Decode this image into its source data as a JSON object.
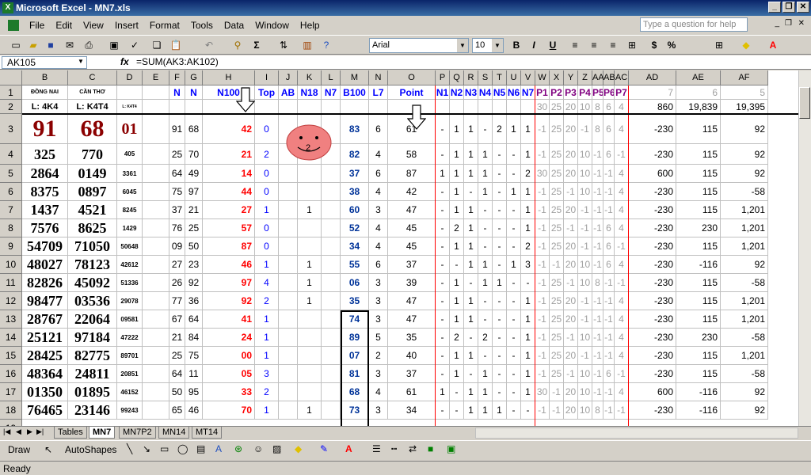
{
  "window": {
    "app_title": "Microsoft Excel - MN7.xls",
    "xl_mark": "X"
  },
  "menu": {
    "items": [
      "File",
      "Edit",
      "View",
      "Insert",
      "Format",
      "Tools",
      "Data",
      "Window",
      "Help"
    ],
    "help_placeholder": "Type a question for help"
  },
  "format": {
    "font": "Arial",
    "size": "10",
    "bold": "B",
    "italic": "I",
    "underline": "U",
    "currency": "$",
    "percent": "%"
  },
  "icons": {
    "new": "new-document-icon",
    "open": "folder-open-icon",
    "save": "save-icon",
    "sigma": "Σ"
  },
  "formula": {
    "name_box": "AK105",
    "fx": "fx",
    "text": "=SUM(AK3:AK102)"
  },
  "columns": [
    "B",
    "C",
    "D",
    "E",
    "F",
    "G",
    "H",
    "I",
    "J",
    "K",
    "L",
    "M",
    "N",
    "O",
    "P",
    "Q",
    "R",
    "S",
    "T",
    "U",
    "V",
    "W",
    "X",
    "Y",
    "Z",
    "AA",
    "AB",
    "AC",
    "AD",
    "AE",
    "AF"
  ],
  "rows": [
    "1",
    "2",
    "3",
    "4",
    "5",
    "6",
    "7",
    "8",
    "9",
    "10",
    "11",
    "12",
    "13",
    "14",
    "15",
    "16",
    "17",
    "18",
    "19"
  ],
  "row1": {
    "B": "ĐỒNG NAI",
    "C": "CẦN THƠ",
    "D": "",
    "F": "N",
    "G": "N",
    "H": "N100",
    "I": "Top",
    "J": "AB",
    "K": "N18",
    "L": "N7",
    "M": "B100",
    "N": "L7",
    "O": "Point",
    "P": "N1",
    "Q": "N2",
    "R": "N3",
    "S": "N4",
    "T": "N5",
    "U": "N6",
    "V": "N7",
    "W": "P1",
    "X": "P2",
    "Y": "P3",
    "Z": "P4",
    "AA": "P5",
    "AB": "P6",
    "AC": "P7",
    "AD": "7",
    "AE": "6",
    "AF": "5"
  },
  "row2": {
    "B": "L: 4K4",
    "C": "L: K4T4",
    "D": "L: K4T4",
    "W": "30",
    "X": "25",
    "Y": "20",
    "Z": "10",
    "AA": "8",
    "AB": "6",
    "AC": "4",
    "AD": "860",
    "AE": "19,839",
    "AF": "19,395"
  },
  "smiley": "2",
  "data": [
    {
      "B": "91",
      "C": "68",
      "D": "01",
      "F": "91",
      "G": "68",
      "H": "42",
      "I": "0",
      "K": "",
      "M": "83",
      "N": "6",
      "O": "61",
      "P": "-",
      "Q": "1",
      "R": "1",
      "S": "-",
      "T": "2",
      "U": "1",
      "V": "1",
      "W": "-1",
      "X": "25",
      "Y": "20",
      "Z": "-1",
      "AA": "8",
      "AB": "6",
      "AC": "4",
      "AD": "-230",
      "AE": "115",
      "AF": "92"
    },
    {
      "B": "325",
      "C": "770",
      "D": "405",
      "F": "25",
      "G": "70",
      "H": "21",
      "I": "2",
      "K": "",
      "M": "82",
      "N": "4",
      "O": "58",
      "P": "-",
      "Q": "1",
      "R": "1",
      "S": "1",
      "T": "-",
      "U": "-",
      "V": "1",
      "W": "-1",
      "X": "25",
      "Y": "20",
      "Z": "10",
      "AA": "-1",
      "AB": "6",
      "AC": "-1",
      "AD": "-230",
      "AE": "115",
      "AF": "92"
    },
    {
      "B": "2864",
      "C": "0149",
      "D": "3361",
      "F": "64",
      "G": "49",
      "H": "14",
      "I": "0",
      "K": "",
      "M": "37",
      "N": "6",
      "O": "87",
      "P": "1",
      "Q": "1",
      "R": "1",
      "S": "1",
      "T": "-",
      "U": "-",
      "V": "2",
      "W": "30",
      "X": "25",
      "Y": "20",
      "Z": "10",
      "AA": "-1",
      "AB": "-1",
      "AC": "4",
      "AD": "600",
      "AE": "115",
      "AF": "92"
    },
    {
      "B": "8375",
      "C": "0897",
      "D": "6045",
      "F": "75",
      "G": "97",
      "H": "44",
      "I": "0",
      "K": "",
      "M": "38",
      "N": "4",
      "O": "42",
      "P": "-",
      "Q": "1",
      "R": "-",
      "S": "1",
      "T": "-",
      "U": "1",
      "V": "1",
      "W": "-1",
      "X": "25",
      "Y": "-1",
      "Z": "10",
      "AA": "-1",
      "AB": "-1",
      "AC": "4",
      "AD": "-230",
      "AE": "115",
      "AF": "-58"
    },
    {
      "B": "1437",
      "C": "4521",
      "D": "8245",
      "F": "37",
      "G": "21",
      "H": "27",
      "I": "1",
      "K": "1",
      "M": "60",
      "N": "3",
      "O": "47",
      "P": "-",
      "Q": "1",
      "R": "1",
      "S": "-",
      "T": "-",
      "U": "-",
      "V": "1",
      "W": "-1",
      "X": "25",
      "Y": "20",
      "Z": "-1",
      "AA": "-1",
      "AB": "-1",
      "AC": "4",
      "AD": "-230",
      "AE": "115",
      "AF": "1,201"
    },
    {
      "B": "7576",
      "C": "8625",
      "D": "1429",
      "F": "76",
      "G": "25",
      "H": "57",
      "I": "0",
      "K": "",
      "M": "52",
      "N": "4",
      "O": "45",
      "P": "-",
      "Q": "2",
      "R": "1",
      "S": "-",
      "T": "-",
      "U": "-",
      "V": "1",
      "W": "-1",
      "X": "25",
      "Y": "-1",
      "Z": "-1",
      "AA": "-1",
      "AB": "6",
      "AC": "4",
      "AD": "-230",
      "AE": "230",
      "AF": "1,201"
    },
    {
      "B": "54709",
      "C": "71050",
      "D": "50648",
      "F": "09",
      "G": "50",
      "H": "87",
      "I": "0",
      "K": "",
      "M": "34",
      "N": "4",
      "O": "45",
      "P": "-",
      "Q": "1",
      "R": "1",
      "S": "-",
      "T": "-",
      "U": "-",
      "V": "2",
      "W": "-1",
      "X": "25",
      "Y": "20",
      "Z": "-1",
      "AA": "-1",
      "AB": "6",
      "AC": "-1",
      "AD": "-230",
      "AE": "115",
      "AF": "1,201"
    },
    {
      "B": "48027",
      "C": "78123",
      "D": "42612",
      "F": "27",
      "G": "23",
      "H": "46",
      "I": "1",
      "K": "1",
      "M": "55",
      "N": "6",
      "O": "37",
      "P": "-",
      "Q": "-",
      "R": "1",
      "S": "1",
      "T": "-",
      "U": "1",
      "V": "3",
      "W": "-1",
      "X": "-1",
      "Y": "20",
      "Z": "10",
      "AA": "-1",
      "AB": "6",
      "AC": "4",
      "AD": "-230",
      "AE": "-116",
      "AF": "92"
    },
    {
      "B": "82826",
      "C": "45092",
      "D": "51336",
      "F": "26",
      "G": "92",
      "H": "97",
      "I": "4",
      "K": "1",
      "M": "06",
      "N": "3",
      "O": "39",
      "P": "-",
      "Q": "1",
      "R": "-",
      "S": "1",
      "T": "1",
      "U": "-",
      "V": "-",
      "W": "-1",
      "X": "25",
      "Y": "-1",
      "Z": "10",
      "AA": "8",
      "AB": "-1",
      "AC": "-1",
      "AD": "-230",
      "AE": "115",
      "AF": "-58"
    },
    {
      "B": "98477",
      "C": "03536",
      "D": "29078",
      "F": "77",
      "G": "36",
      "H": "92",
      "I": "2",
      "K": "1",
      "M": "35",
      "N": "3",
      "O": "47",
      "P": "-",
      "Q": "1",
      "R": "1",
      "S": "-",
      "T": "-",
      "U": "-",
      "V": "1",
      "W": "-1",
      "X": "25",
      "Y": "20",
      "Z": "-1",
      "AA": "-1",
      "AB": "-1",
      "AC": "4",
      "AD": "-230",
      "AE": "115",
      "AF": "1,201"
    },
    {
      "B": "28767",
      "C": "22064",
      "D": "09581",
      "F": "67",
      "G": "64",
      "H": "41",
      "I": "1",
      "K": "",
      "M": "74",
      "N": "3",
      "O": "47",
      "P": "-",
      "Q": "1",
      "R": "1",
      "S": "-",
      "T": "-",
      "U": "-",
      "V": "1",
      "W": "-1",
      "X": "25",
      "Y": "20",
      "Z": "-1",
      "AA": "-1",
      "AB": "-1",
      "AC": "4",
      "AD": "-230",
      "AE": "115",
      "AF": "1,201"
    },
    {
      "B": "25121",
      "C": "97184",
      "D": "47222",
      "F": "21",
      "G": "84",
      "H": "24",
      "I": "1",
      "K": "",
      "M": "89",
      "N": "5",
      "O": "35",
      "P": "-",
      "Q": "2",
      "R": "-",
      "S": "2",
      "T": "-",
      "U": "-",
      "V": "1",
      "W": "-1",
      "X": "25",
      "Y": "-1",
      "Z": "10",
      "AA": "-1",
      "AB": "-1",
      "AC": "4",
      "AD": "-230",
      "AE": "230",
      "AF": "-58"
    },
    {
      "B": "28425",
      "C": "82775",
      "D": "89701",
      "F": "25",
      "G": "75",
      "H": "00",
      "I": "1",
      "K": "",
      "M": "07",
      "N": "2",
      "O": "40",
      "P": "-",
      "Q": "1",
      "R": "1",
      "S": "-",
      "T": "-",
      "U": "-",
      "V": "1",
      "W": "-1",
      "X": "25",
      "Y": "20",
      "Z": "-1",
      "AA": "-1",
      "AB": "-1",
      "AC": "4",
      "AD": "-230",
      "AE": "115",
      "AF": "1,201"
    },
    {
      "B": "48364",
      "C": "24811",
      "D": "20851",
      "F": "64",
      "G": "11",
      "H": "05",
      "I": "3",
      "K": "",
      "M": "81",
      "N": "3",
      "O": "37",
      "P": "-",
      "Q": "1",
      "R": "-",
      "S": "1",
      "T": "-",
      "U": "-",
      "V": "1",
      "W": "-1",
      "X": "25",
      "Y": "-1",
      "Z": "10",
      "AA": "-1",
      "AB": "6",
      "AC": "-1",
      "AD": "-230",
      "AE": "115",
      "AF": "-58"
    },
    {
      "B": "01350",
      "C": "01895",
      "D": "46152",
      "F": "50",
      "G": "95",
      "H": "33",
      "I": "2",
      "K": "",
      "M": "68",
      "N": "4",
      "O": "61",
      "P": "1",
      "Q": "-",
      "R": "1",
      "S": "1",
      "T": "-",
      "U": "-",
      "V": "1",
      "W": "30",
      "X": "-1",
      "Y": "20",
      "Z": "10",
      "AA": "-1",
      "AB": "-1",
      "AC": "4",
      "AD": "600",
      "AE": "-116",
      "AF": "92"
    },
    {
      "B": "76465",
      "C": "23146",
      "D": "99243",
      "F": "65",
      "G": "46",
      "H": "70",
      "I": "1",
      "K": "1",
      "M": "73",
      "N": "3",
      "O": "34",
      "P": "-",
      "Q": "-",
      "R": "1",
      "S": "1",
      "T": "1",
      "U": "-",
      "V": "-",
      "W": "-1",
      "X": "-1",
      "Y": "20",
      "Z": "10",
      "AA": "8",
      "AB": "-1",
      "AC": "-1",
      "AD": "-230",
      "AE": "-116",
      "AF": "92"
    }
  ],
  "sheets": [
    "Tables",
    "MN7",
    "MN7P2",
    "MN14",
    "MT14"
  ],
  "active_sheet": "MN7",
  "drawing": {
    "draw": "Draw",
    "autoshapes": "AutoShapes"
  },
  "status": "Ready"
}
